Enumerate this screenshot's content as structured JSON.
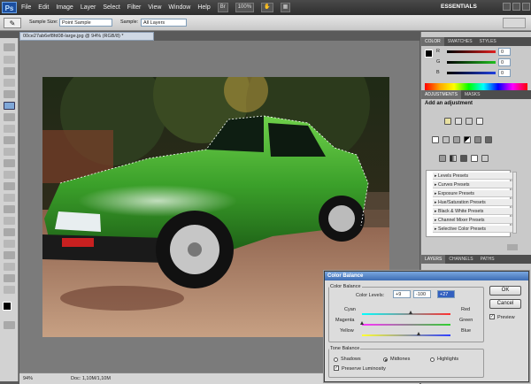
{
  "app": {
    "logo": "Ps",
    "workspace": "ESSENTIALS"
  },
  "menu": [
    "File",
    "Edit",
    "Image",
    "Layer",
    "Select",
    "Filter",
    "View",
    "Window",
    "Help"
  ],
  "menu_toolbar_buttons": [
    {
      "label": "Br"
    },
    {
      "label": "100%"
    }
  ],
  "options_bar": {
    "sample_size_label": "Sample Size:",
    "sample_size_value": "Point Sample",
    "sample_label": "Sample:",
    "sample_value": "All Layers"
  },
  "document": {
    "tab_title": "00ce27ab6ef8fd08-large.jpg @ 94% (RGB/8) *",
    "zoom": "94%",
    "doc_info": "Doc: 1,10M/1,10M"
  },
  "color_panel": {
    "tabs": [
      "COLOR",
      "SWATCHES",
      "STYLES"
    ],
    "channels": [
      {
        "label": "R",
        "value": "0",
        "color": "#e02020"
      },
      {
        "label": "G",
        "value": "0",
        "color": "#20c020"
      },
      {
        "label": "B",
        "value": "0",
        "color": "#2040e0"
      }
    ]
  },
  "adjustments_panel": {
    "tabs": [
      "ADJUSTMENTS",
      "MASKS"
    ],
    "heading": "Add an adjustment",
    "presets": [
      "Levels Presets",
      "Curves Presets",
      "Exposure Presets",
      "Hue/Saturation Presets",
      "Black & White Presets",
      "Channel Mixer Presets",
      "Selective Color Presets"
    ]
  },
  "layers_panel": {
    "tabs": [
      "LAYERS",
      "CHANNELS",
      "PATHS"
    ]
  },
  "color_balance": {
    "title": "Color Balance",
    "group_label": "Color Balance",
    "levels_label": "Color Levels:",
    "levels": [
      "+9",
      "-100",
      "+27"
    ],
    "sliders": [
      {
        "left": "Cyan",
        "right": "Red",
        "value": 9
      },
      {
        "left": "Magenta",
        "right": "Green",
        "value": -100
      },
      {
        "left": "Yellow",
        "right": "Blue",
        "value": 27
      }
    ],
    "tone_balance_label": "Tone Balance",
    "tones": [
      "Shadows",
      "Midtones",
      "Highlights"
    ],
    "selected_tone": "Midtones",
    "preserve_luminosity": "Preserve Luminosity",
    "preserve_checked": true,
    "ok": "OK",
    "cancel": "Cancel",
    "preview": "Preview",
    "preview_checked": true
  },
  "colors": {
    "accent": "#1c4fa0",
    "title_bar": "#3d6cb4"
  }
}
